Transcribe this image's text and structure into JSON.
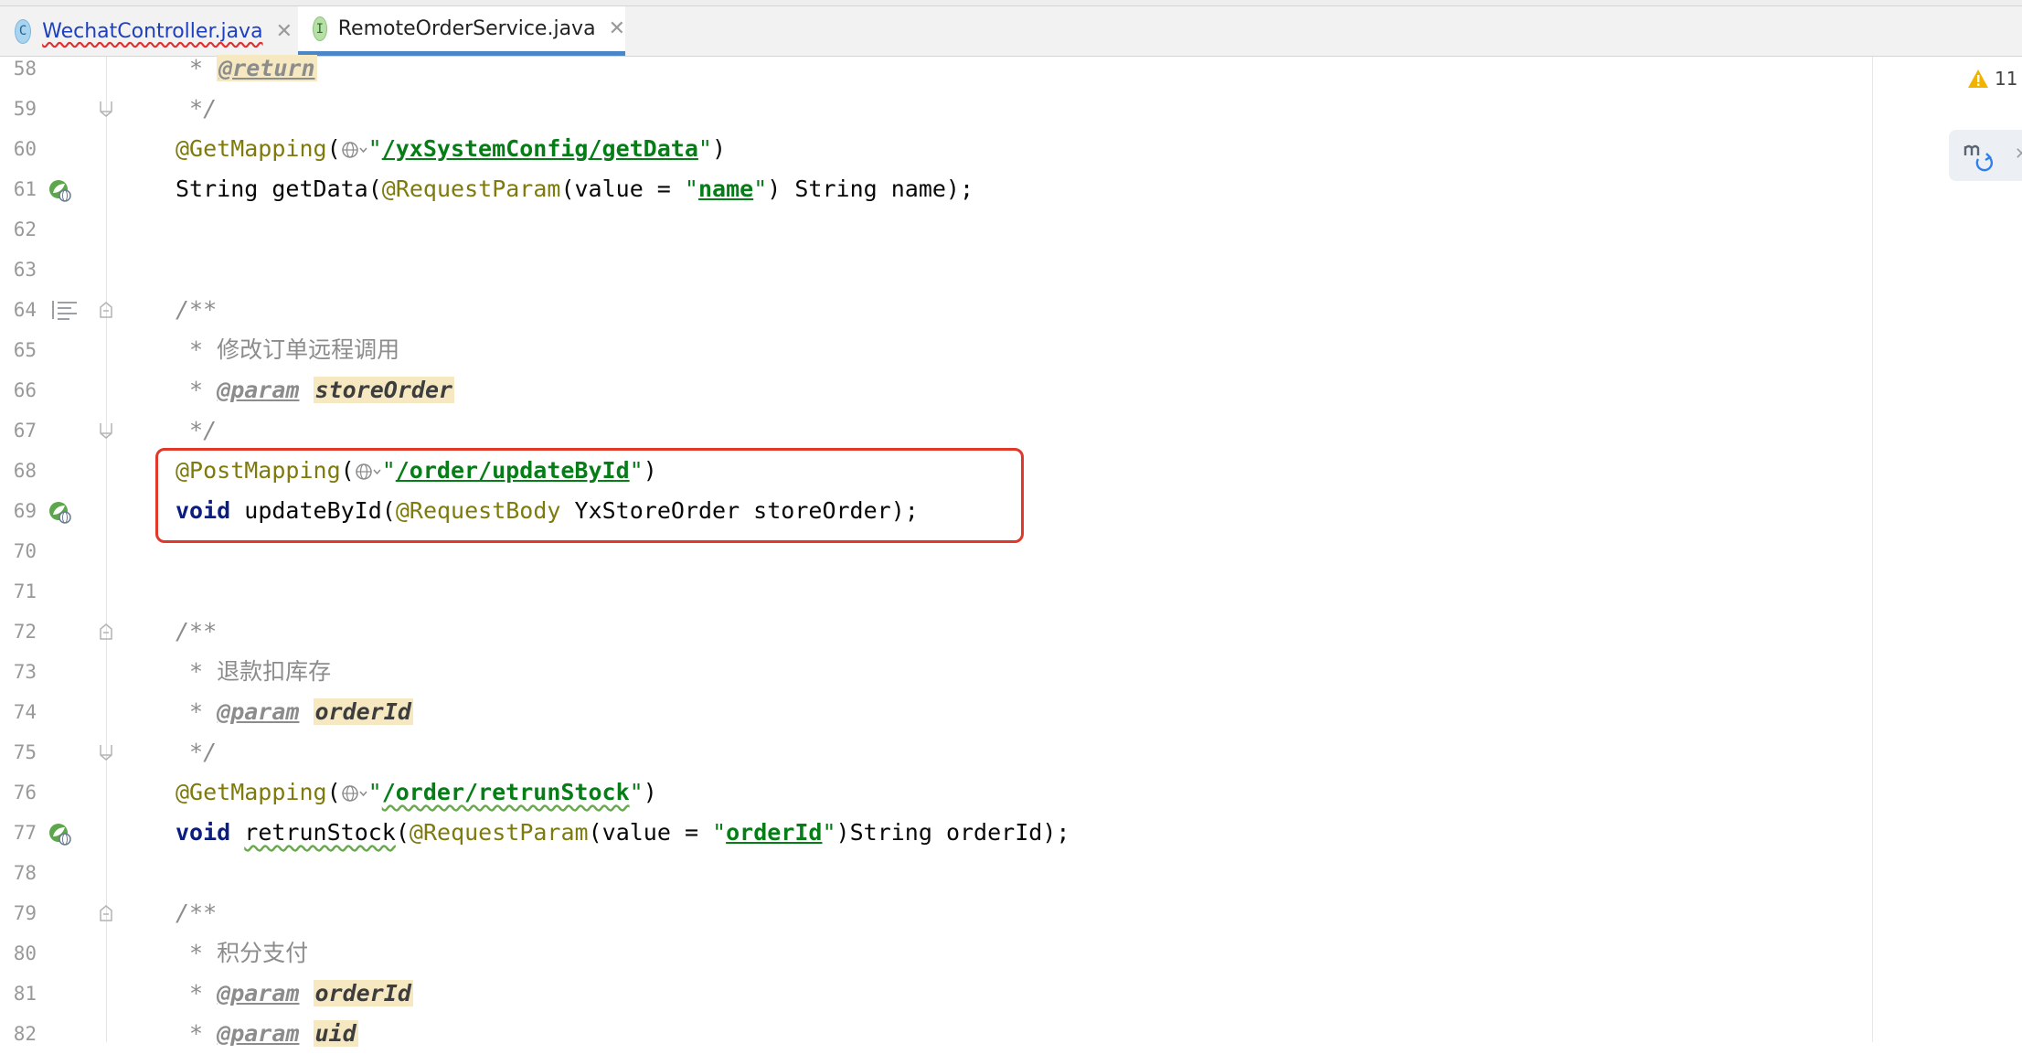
{
  "tabs": [
    {
      "label": "WechatController.java",
      "icon": "class-icon",
      "icon_letter": "C",
      "active": false
    },
    {
      "label": "RemoteOrderService.java",
      "icon": "interface-icon",
      "icon_letter": "I",
      "active": true
    }
  ],
  "tab_close_glyph": "✕",
  "inspections": {
    "warning_count": "11"
  },
  "line_numbers": [
    "58",
    "59",
    "60",
    "61",
    "62",
    "63",
    "64",
    "65",
    "66",
    "67",
    "68",
    "69",
    "70",
    "71",
    "72",
    "73",
    "74",
    "75",
    "76",
    "77",
    "78",
    "79",
    "80",
    "81",
    "82"
  ],
  "code": {
    "l58": {
      "star": " * ",
      "tag": "@return"
    },
    "l59": {
      "text": " */"
    },
    "l60": {
      "ann": "@GetMapping",
      "p1": "(",
      "q1": "\"",
      "url": "/yxSystemConfig/getData",
      "q2": "\"",
      "p2": ")"
    },
    "l61": {
      "t1": "String getData(",
      "ann": "@RequestParam",
      "t2": "(value = ",
      "q1": "\"",
      "s": "name",
      "q2": "\"",
      "t3": ") String name);"
    },
    "l64": {
      "text": "/**"
    },
    "l65": {
      "star": " * ",
      "text": "修改订单远程调用"
    },
    "l66": {
      "star": " * ",
      "tag": "@param",
      "sp": " ",
      "name": "storeOrder"
    },
    "l67": {
      "text": " */"
    },
    "l68": {
      "ann": "@PostMapping",
      "p1": "(",
      "q1": "\"",
      "url": "/order/updateById",
      "q2": "\"",
      "p2": ")"
    },
    "l69": {
      "kw": "void",
      "t1": " updateById(",
      "ann": "@RequestBody",
      "t2": " YxStoreOrder storeOrder);"
    },
    "l72": {
      "text": "/**"
    },
    "l73": {
      "star": " * ",
      "text": "退款扣库存"
    },
    "l74": {
      "star": " * ",
      "tag": "@param",
      "sp": " ",
      "name": "orderId"
    },
    "l75": {
      "text": " */"
    },
    "l76": {
      "ann": "@GetMapping",
      "p1": "(",
      "q1": "\"",
      "url": "/order/retrunStock",
      "q2": "\"",
      "p2": ")"
    },
    "l77": {
      "kw": "void",
      "sp": " ",
      "m": "retrunStock",
      "t1": "(",
      "ann": "@RequestParam",
      "t2": "(value = ",
      "q1": "\"",
      "s": "orderId",
      "q2": "\"",
      "t3": ")String orderId);"
    },
    "l79": {
      "text": "/**"
    },
    "l80": {
      "star": " * ",
      "text": "积分支付"
    },
    "l81": {
      "star": " * ",
      "tag": "@param",
      "sp": " ",
      "name": "orderId"
    },
    "l82": {
      "star": " * ",
      "tag": "@param",
      "sp": " ",
      "name": "uid"
    }
  },
  "colors": {
    "keyword": "#0c1d80",
    "annotation": "#7e7a0c",
    "string": "#067d17",
    "comment": "#8c8c8c",
    "highlight_box": "#e0392b"
  }
}
